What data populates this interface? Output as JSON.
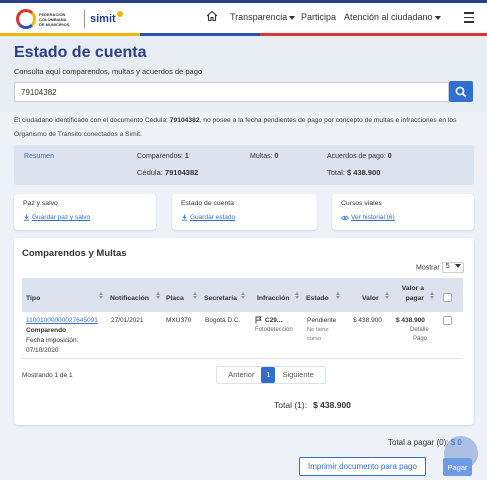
{
  "brand": {
    "org_line1": "FEDERACIÓN",
    "org_line2": "COLOMBIANA",
    "org_line3": "DE MUNICIPIOS",
    "product": "simit"
  },
  "nav": {
    "items": [
      "Transparencia",
      "Participa",
      "Atención al ciudadano"
    ]
  },
  "page": {
    "title": "Estado de cuenta",
    "subtitle": "Consulta aquí comparendos, multas y acuerdos de pago"
  },
  "search": {
    "value": "79104382",
    "icon": "search-icon"
  },
  "info": {
    "prefix": "El ciudadano identificado con el documento Cédula: ",
    "document": "79104382",
    "suffix": ", no posee a la fecha pendientes de pago por concepto de multas e infracciones en los Organismo de Tránsito conectados a Simit."
  },
  "summary": {
    "link": "Resumen",
    "comparendos_label": "Comparendos:",
    "comparendos_value": "1",
    "multas_label": "Multas:",
    "multas_value": "0",
    "acuerdos_label": "Acuerdos de pago:",
    "acuerdos_value": "0",
    "cedula_label": "Cédula:",
    "cedula_value": "79104382",
    "total_label": "Total:",
    "total_value": "$ 438.900"
  },
  "cards": [
    {
      "title": "Paz y salvo",
      "link": "Guardar paz y salvo",
      "icon": "download-icon"
    },
    {
      "title": "Estado de cuenta",
      "link": "Guardar estado",
      "icon": "download-icon"
    },
    {
      "title": "Cursos viales",
      "link": "Ver historial (6)",
      "icon": "eye-icon"
    }
  ],
  "table": {
    "title": "Comparendos y Multas",
    "show_label": "Mostrar",
    "show_value": "5",
    "headers": [
      "Tipo",
      "Notificación",
      "Placa",
      "Secretaría",
      "Infracción",
      "Estado",
      "Valor",
      "Valor a",
      "pagar"
    ],
    "row": {
      "number": "11001000000027645091",
      "type": "Comparendo",
      "date_label": "Fecha imposición:",
      "date": "07/10/2020",
      "notification": "27/01/2021",
      "plate": "MXU370",
      "secretaria": "Bogotá D.C.",
      "infraccion": "C29...",
      "infraccion_sub": "Fotodetección",
      "estado": "Pendiente",
      "estado_sub1": "No tiene",
      "estado_sub2": "curso",
      "valor": "$ 438.900",
      "valor_pagar": "$ 438.900",
      "detalle1": "Detalle",
      "detalle2": "Pago"
    },
    "showing": "Mostrando 1 de 1",
    "pager": {
      "prev": "Anterior",
      "page": "1",
      "next": "Siguiente"
    },
    "total_label": "Total (1):",
    "total_value": "$ 438.900"
  },
  "footer": {
    "grand_label": "Total a pagar (0):",
    "grand_value": "$ 0",
    "print_label": "Imprimir documento para pago",
    "pay_label": "Pagar"
  },
  "colors": {
    "primary": "#2a3f8a",
    "accent": "#2f6fd0",
    "stripe_yellow": "#f2b705",
    "stripe_red": "#d33"
  }
}
